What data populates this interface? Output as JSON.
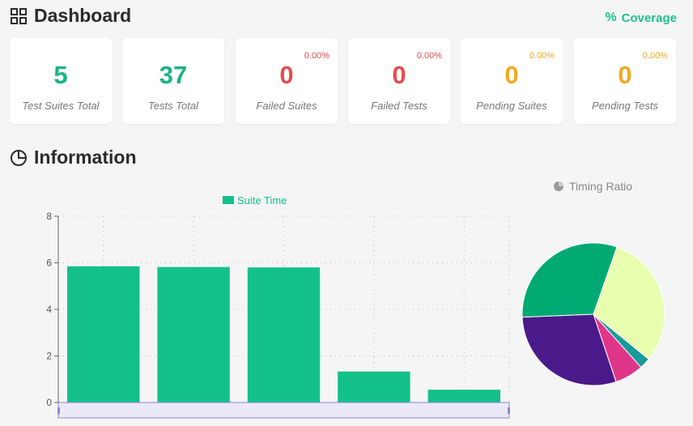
{
  "header": {
    "title": "Dashboard",
    "coverage_label": "Coverage"
  },
  "cards": [
    {
      "value": "5",
      "label": "Test Suites Total",
      "percent": "",
      "color": "green"
    },
    {
      "value": "37",
      "label": "Tests Total",
      "percent": "",
      "color": "green"
    },
    {
      "value": "0",
      "label": "Failed Suites",
      "percent": "0.00%",
      "color": "red"
    },
    {
      "value": "0",
      "label": "Failed Tests",
      "percent": "0.00%",
      "color": "red"
    },
    {
      "value": "0",
      "label": "Pending Suites",
      "percent": "0.00%",
      "color": "orange"
    },
    {
      "value": "0",
      "label": "Pending Tests",
      "percent": "0.00%",
      "color": "orange"
    }
  ],
  "info": {
    "title": "Information"
  },
  "colors": {
    "accent": "#1fbf8f",
    "bar": "#13c08a",
    "failed": "#e64b4b",
    "pending": "#f0a920"
  },
  "chart_data": [
    {
      "type": "bar",
      "categories": [
        "",
        "",
        "",
        "",
        ""
      ],
      "series": [
        {
          "name": "Suite Time",
          "values": [
            5.85,
            5.82,
            5.8,
            1.33,
            0.55
          ]
        }
      ],
      "ylim": [
        0,
        8
      ],
      "yticks": [
        "0",
        "2",
        "4",
        "6",
        "8"
      ],
      "grid": true,
      "legend": "top-center"
    },
    {
      "type": "pie",
      "title": "Timing Ratio",
      "slices": [
        {
          "value": 30.5,
          "color": "#e8ffb0"
        },
        {
          "value": 2.5,
          "color": "#1a9a9a"
        },
        {
          "value": 6.5,
          "color": "#e0368a"
        },
        {
          "value": 29.5,
          "color": "#4a1a8a"
        },
        {
          "value": 31.0,
          "color": "#00aa72"
        }
      ]
    }
  ]
}
